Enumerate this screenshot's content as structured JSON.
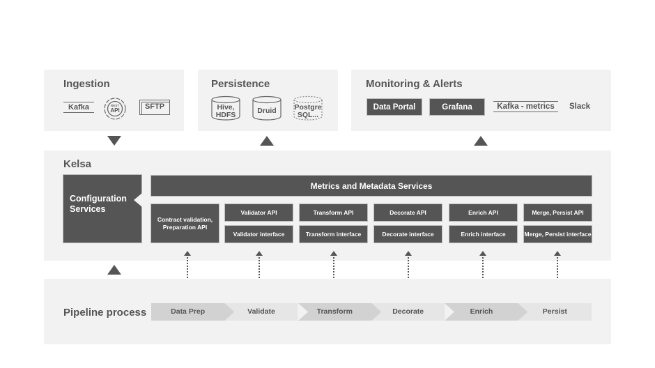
{
  "ingestion": {
    "title": "Ingestion",
    "items": [
      "Kafka",
      "REST",
      "API",
      "SFTP"
    ]
  },
  "persistence": {
    "title": "Persistence",
    "stores": [
      {
        "line1": "Hive,",
        "line2": "HDFS"
      },
      {
        "line1": "Druid",
        "line2": ""
      },
      {
        "line1": "Postgre",
        "line2": "SQL..."
      }
    ]
  },
  "monitoring": {
    "title": "Monitoring & Alerts",
    "items": [
      "Data Portal",
      "Grafana",
      "Kafka - metrics",
      "Slack"
    ]
  },
  "kelsa": {
    "title": "Kelsa",
    "config_services": "Configuration Services",
    "metrics_services": "Metrics and Metadata Services",
    "contract_box": "Contract validation, Preparation API",
    "modules": [
      {
        "api": "Validator API",
        "interface": "Validator interface"
      },
      {
        "api": "Transform API",
        "interface": "Transform interface"
      },
      {
        "api": "Decorate API",
        "interface": "Decorate interface"
      },
      {
        "api": "Enrich API",
        "interface": "Enrich interface"
      },
      {
        "api": "Merge, Persist API",
        "interface": "Merge, Persist interface"
      }
    ]
  },
  "pipeline": {
    "title": "Pipeline process",
    "steps": [
      "Data Prep",
      "Validate",
      "Transform",
      "Decorate",
      "Enrich",
      "Persist"
    ]
  },
  "colors": {
    "panel": "#f2f2f2",
    "dark_box": "#555555",
    "step_dark": "#d2d2d2",
    "step_light": "#e6e6e6"
  }
}
